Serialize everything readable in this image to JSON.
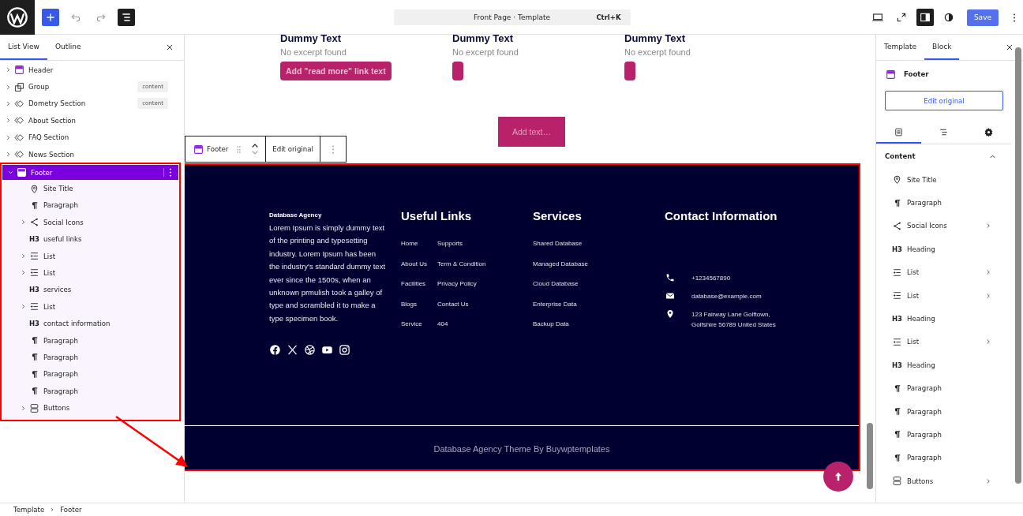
{
  "toolbar": {
    "command_title": "Front Page · Template",
    "shortcut": "Ctrl+K",
    "save": "Save"
  },
  "list_panel": {
    "tabs": [
      {
        "label": "List View",
        "selected": true
      },
      {
        "label": "Outline",
        "selected": false
      }
    ],
    "items": [
      {
        "kind": "template-part",
        "label": "Header",
        "selected": false,
        "expanded": false
      },
      {
        "kind": "group",
        "label": "Group",
        "tag": "content",
        "selected": false,
        "expanded": false
      },
      {
        "kind": "pattern",
        "label": "Dometry Section",
        "tag": "content",
        "selected": false,
        "expanded": false
      },
      {
        "kind": "pattern",
        "label": "About Section",
        "selected": false,
        "expanded": false
      },
      {
        "kind": "pattern",
        "label": "FAQ Section",
        "selected": false,
        "expanded": false
      },
      {
        "kind": "pattern",
        "label": "News Section",
        "selected": false,
        "expanded": false
      },
      {
        "kind": "template-part",
        "label": "Footer",
        "selected": true,
        "expanded": true,
        "children": [
          {
            "kind": "site-title",
            "label": "Site Title",
            "selected": false
          },
          {
            "kind": "paragraph",
            "label": "Paragraph",
            "selected": false
          },
          {
            "kind": "social",
            "label": "Social Icons",
            "selected": false,
            "expanded": false
          },
          {
            "kind": "heading",
            "badge": "H3",
            "label": "useful links",
            "selected": false
          },
          {
            "kind": "list",
            "label": "List",
            "selected": false,
            "expanded": false
          },
          {
            "kind": "list",
            "label": "List",
            "selected": false,
            "expanded": false
          },
          {
            "kind": "heading",
            "badge": "H3",
            "label": "services",
            "selected": false
          },
          {
            "kind": "list",
            "label": "List",
            "selected": false,
            "expanded": false
          },
          {
            "kind": "heading",
            "badge": "H3",
            "label": "contact information",
            "selected": false
          },
          {
            "kind": "paragraph",
            "label": "Paragraph",
            "selected": false
          },
          {
            "kind": "paragraph",
            "label": "Paragraph",
            "selected": false
          },
          {
            "kind": "paragraph",
            "label": "Paragraph",
            "selected": false
          },
          {
            "kind": "paragraph",
            "label": "Paragraph",
            "selected": false
          },
          {
            "kind": "buttons",
            "label": "Buttons",
            "selected": false,
            "expanded": false
          }
        ]
      }
    ]
  },
  "canvas": {
    "posts": [
      {
        "title": "Dummy Text",
        "excerpt": "No excerpt found",
        "button": "Add \"read more\" link text"
      },
      {
        "title": "Dummy Text",
        "excerpt": "No excerpt found"
      },
      {
        "title": "Dummy Text",
        "excerpt": "No excerpt found"
      }
    ],
    "add_text": "Add text…",
    "block_toolbar": {
      "label": "Footer",
      "edit": "Edit original"
    },
    "footer": {
      "site_title": "Database Agency",
      "about": "Lorem Ipsum is simply dummy text of the printing and typesetting industry. Lorem Ipsum has been the industry's standard dummy text ever since the 1500s, when an unknown prmulish took a galley of type and scrambled it to make a type specimen book.",
      "useful_links": {
        "heading": "Useful Links",
        "column_1": [
          "Home",
          "About Us",
          "Facilities",
          "Blogs",
          "Service"
        ],
        "column_2": [
          "Supports",
          "Term & Condition",
          "Privacy Policy",
          "Contact Us",
          "404"
        ]
      },
      "services": {
        "heading": "Services",
        "items": [
          "Shared Database",
          "Managed Database",
          "Cloud Database",
          "Enterprise Data",
          "Backup Data"
        ]
      },
      "contact": {
        "heading": "Contact Information",
        "rows": [
          {
            "kind": "phone",
            "text": "+1234567890"
          },
          {
            "kind": "email",
            "text": "database@example.com"
          },
          {
            "kind": "address",
            "text": "123 Fairway Lane Golftown,\nGolfshire 56789 United States"
          }
        ]
      },
      "copyright": "Database Agency Theme By Buywptemplates"
    }
  },
  "inspector": {
    "tabs": [
      {
        "label": "Template",
        "selected": false
      },
      {
        "label": "Block",
        "selected": true
      }
    ],
    "block_name": "Footer",
    "edit_button": "Edit original",
    "section_tabs": [
      {
        "kind": "content",
        "selected": true
      },
      {
        "kind": "list",
        "selected": false
      },
      {
        "kind": "settings",
        "selected": false
      }
    ],
    "section_title": "Content",
    "section_expanded": true,
    "items": [
      {
        "kind": "site-title",
        "label": "Site Title"
      },
      {
        "kind": "paragraph",
        "label": "Paragraph"
      },
      {
        "kind": "social",
        "label": "Social Icons",
        "expanded": false
      },
      {
        "kind": "heading",
        "badge": "H3",
        "label": "Heading"
      },
      {
        "kind": "list",
        "label": "List",
        "expanded": false
      },
      {
        "kind": "list",
        "label": "List",
        "expanded": false
      },
      {
        "kind": "heading",
        "badge": "H3",
        "label": "Heading"
      },
      {
        "kind": "list",
        "label": "List",
        "expanded": false
      },
      {
        "kind": "heading",
        "badge": "H3",
        "label": "Heading"
      },
      {
        "kind": "paragraph",
        "label": "Paragraph"
      },
      {
        "kind": "paragraph",
        "label": "Paragraph"
      },
      {
        "kind": "paragraph",
        "label": "Paragraph"
      },
      {
        "kind": "paragraph",
        "label": "Paragraph"
      },
      {
        "kind": "buttons",
        "label": "Buttons",
        "expanded": false
      }
    ]
  },
  "breadcrumb": [
    "Template",
    "Footer"
  ]
}
